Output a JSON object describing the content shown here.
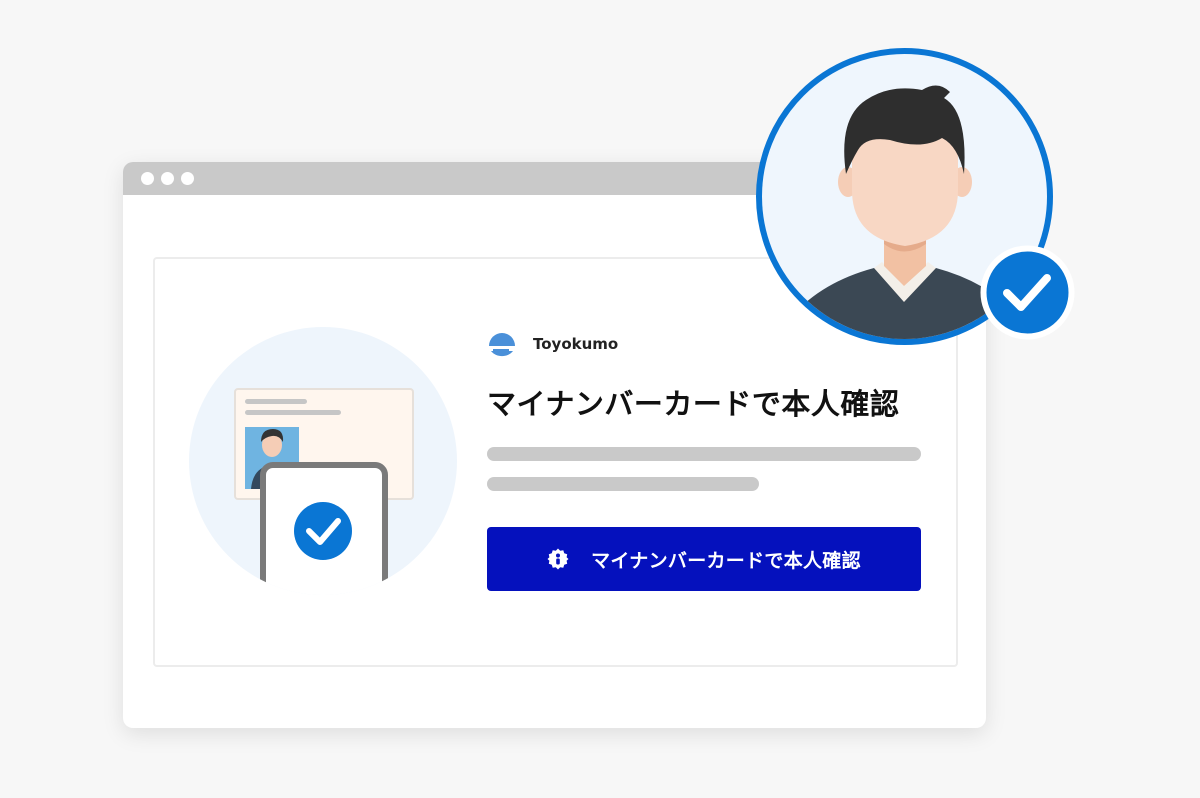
{
  "window": {
    "titlebar_dots": 3
  },
  "brand": {
    "name": "Toyokumo",
    "logo_icon": "toyokumo-cloud-logo"
  },
  "main": {
    "headline": "マイナンバーカードで本人確認",
    "primary_button": {
      "label": "マイナンバーカードで本人確認",
      "icon": "mynumber-badge-icon"
    }
  },
  "colors": {
    "page_bg": "#f7f7f7",
    "titlebar": "#c9c9c9",
    "primary_button": "#0511bd",
    "accent_blue": "#0a76d4",
    "placeholder_bar": "#c9c9c9"
  }
}
